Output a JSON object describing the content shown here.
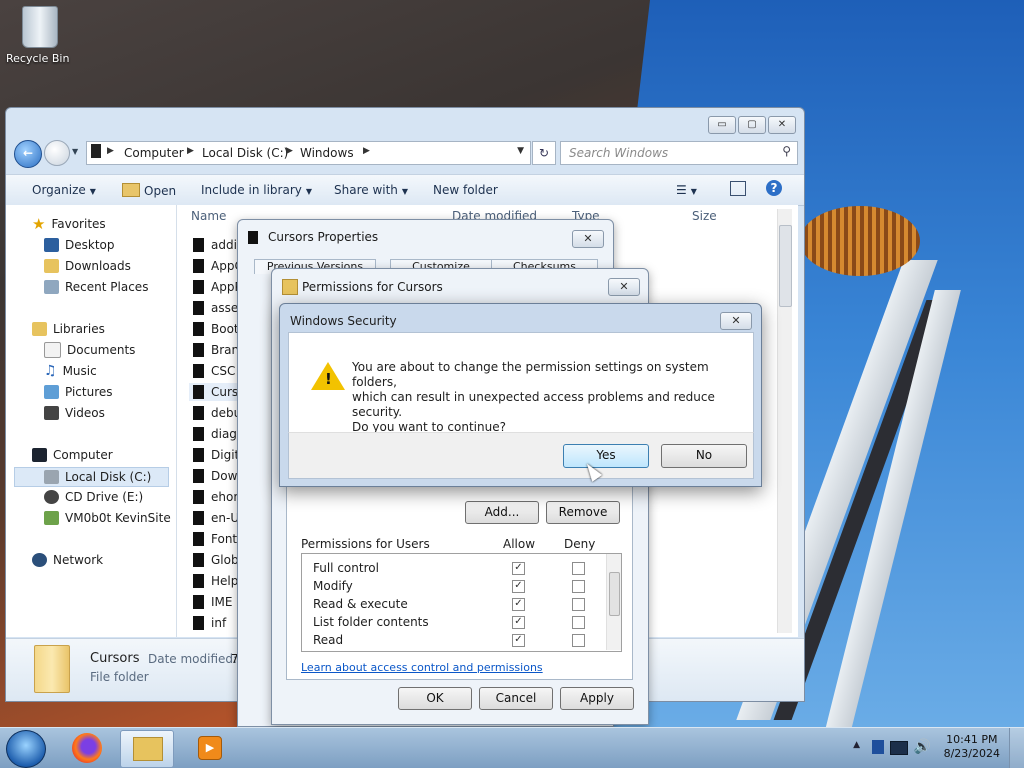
{
  "desktop": {
    "recycle_bin_label": "Recycle Bin"
  },
  "explorer": {
    "window_buttons": {
      "minimize": "▭",
      "maximize": "▢",
      "close": "✕"
    },
    "address": {
      "segments": [
        "Computer",
        "Local Disk (C:)",
        "Windows"
      ]
    },
    "search_placeholder": "Search Windows",
    "toolbar": {
      "organize": "Organize",
      "open": "Open",
      "include_in_library": "Include in library",
      "share_with": "Share with",
      "new_folder": "New folder"
    },
    "nav": {
      "favorites": "Favorites",
      "desktop": "Desktop",
      "downloads": "Downloads",
      "recent_places": "Recent Places",
      "libraries": "Libraries",
      "documents": "Documents",
      "music": "Music",
      "pictures": "Pictures",
      "videos": "Videos",
      "computer": "Computer",
      "local_disk": "Local Disk (C:)",
      "cd_drive": "CD Drive (E:)",
      "vm_share": "VM0b0t KevinSite",
      "network": "Network"
    },
    "columns": {
      "name": "Name",
      "date_modified": "Date modified",
      "type": "Type",
      "size": "Size"
    },
    "files": [
      "addin",
      "AppC",
      "AppP",
      "asser",
      "Boot",
      "Brand",
      "CSC",
      "Curs",
      "debu",
      "diagr",
      "Digit",
      "Dowr",
      "ehom",
      "en-U",
      "Fonts",
      "Glob",
      "Help",
      "IME",
      "inf"
    ],
    "details": {
      "name": "Cursors",
      "date_label": "Date modified:",
      "date_value": "7",
      "type": "File folder"
    }
  },
  "cursors_properties": {
    "title": "Cursors Properties",
    "tabs": [
      "Previous Versions",
      "Customize",
      "Checksums"
    ],
    "close": "✕"
  },
  "permissions": {
    "title": "Permissions for Cursors",
    "close": "✕",
    "add": "Add...",
    "remove": "Remove",
    "perm_header": "Permissions for Users",
    "allow": "Allow",
    "deny": "Deny",
    "rows": [
      {
        "label": "Full control",
        "allow": true,
        "deny": false
      },
      {
        "label": "Modify",
        "allow": true,
        "deny": false
      },
      {
        "label": "Read & execute",
        "allow": true,
        "deny": false
      },
      {
        "label": "List folder contents",
        "allow": true,
        "deny": false
      },
      {
        "label": "Read",
        "allow": true,
        "deny": false
      }
    ],
    "link": "Learn about access control and permissions",
    "ok": "OK",
    "cancel": "Cancel",
    "apply": "Apply"
  },
  "security": {
    "title": "Windows Security",
    "close": "✕",
    "line1": "You are about to change the permission settings on system folders,",
    "line2": "which can result in unexpected access problems and reduce security.",
    "line3": "Do you want to continue?",
    "yes": "Yes",
    "no": "No"
  },
  "taskbar": {
    "time": "10:41 PM",
    "date": "8/23/2024"
  },
  "colors": {
    "link": "#0b57c8",
    "selection": "#dce9f7",
    "warning": "#f2c200"
  }
}
